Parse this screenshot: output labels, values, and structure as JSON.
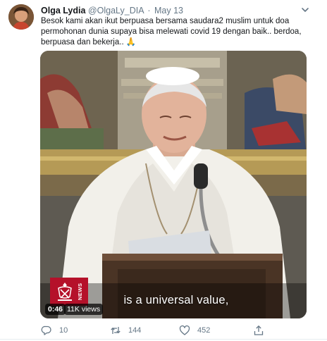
{
  "tweet": {
    "author_name": "Olga Lydia",
    "handle": "@OlgaLy_DIA",
    "separator": "·",
    "date": "May 13",
    "text": "Besok kami akan ikut berpuasa bersama saudara2 muslim untuk doa permohonan dunia supaya bisa melewati covid 19 dengan baik.. berdoa, berpuasa dan bekerja..",
    "text_emoji": "🙏"
  },
  "video": {
    "caption": "is a universal value,",
    "duration": "0:46",
    "views": "11K views",
    "logo_text": "NEWS"
  },
  "actions": {
    "replies": "10",
    "retweets": "144",
    "likes": "452"
  },
  "icons": {
    "caret": "chevron-down-icon",
    "reply": "reply-icon",
    "retweet": "retweet-icon",
    "like": "heart-icon",
    "share": "share-icon"
  },
  "colors": {
    "text": "#14171a",
    "secondary": "#657786",
    "logo_red": "#b5112a"
  }
}
